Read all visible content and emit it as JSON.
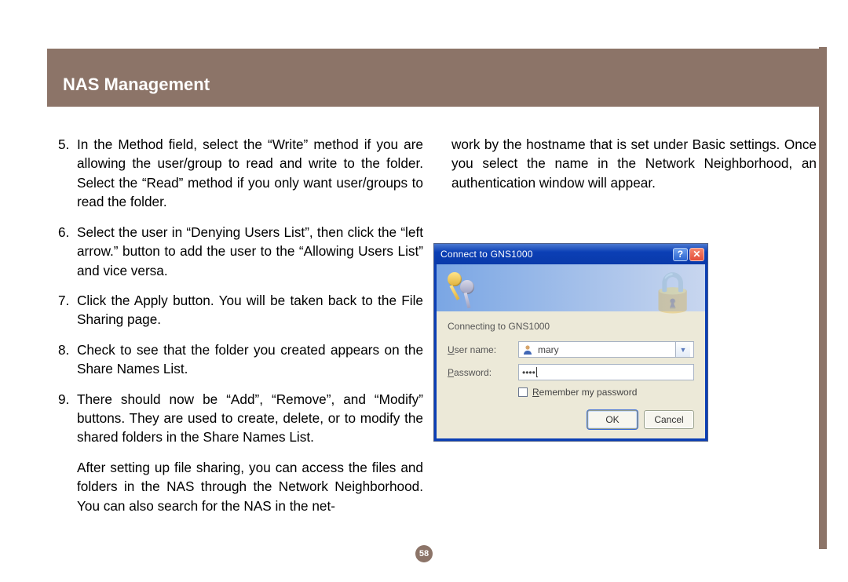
{
  "header": {
    "title": "NAS Management"
  },
  "page_number": "58",
  "left_column": {
    "items": [
      {
        "num": "5.",
        "text": "In the Method field, select the “Write” method if you are allowing the user/group to read and write to the folder. Select the “Read” method if you only want user/groups to read the folder."
      },
      {
        "num": "6.",
        "text": "Select the user in “Denying Users List”, then click the “left arrow.” button to add the user to the “Allowing Users List” and vice versa."
      },
      {
        "num": "7.",
        "text": "Click the Apply button. You will be taken back to the File Sharing page."
      },
      {
        "num": "8.",
        "text": "Check to see that the folder you created appears on the Share Names List."
      },
      {
        "num": "9.",
        "text": "There should now be “Add”, “Remove”, and “Modify” buttons. They are used to create, delete, or to modify the shared folders in the Share Names List."
      }
    ],
    "closing": "After setting up file sharing, you can access the files and folders in the NAS through the Network Neighborhood. You can also search for the NAS in the net-"
  },
  "right_column": {
    "opening": "work by the hostname that is set under Basic settings. Once you select the name in the Network Neighborhood, an authentication window will appear."
  },
  "dialog": {
    "title_prefix": "Connect to ",
    "title_host": "GNS1000",
    "connecting_prefix": "Connecting to ",
    "connecting_host": "GNS1000",
    "username_label_pre": "U",
    "username_label_rest": "ser name:",
    "username_value": "mary",
    "password_label_pre": "P",
    "password_label_rest": "assword:",
    "password_mask": "••••",
    "remember_pre": "R",
    "remember_rest": "emember my password",
    "ok": "OK",
    "cancel": "Cancel"
  }
}
